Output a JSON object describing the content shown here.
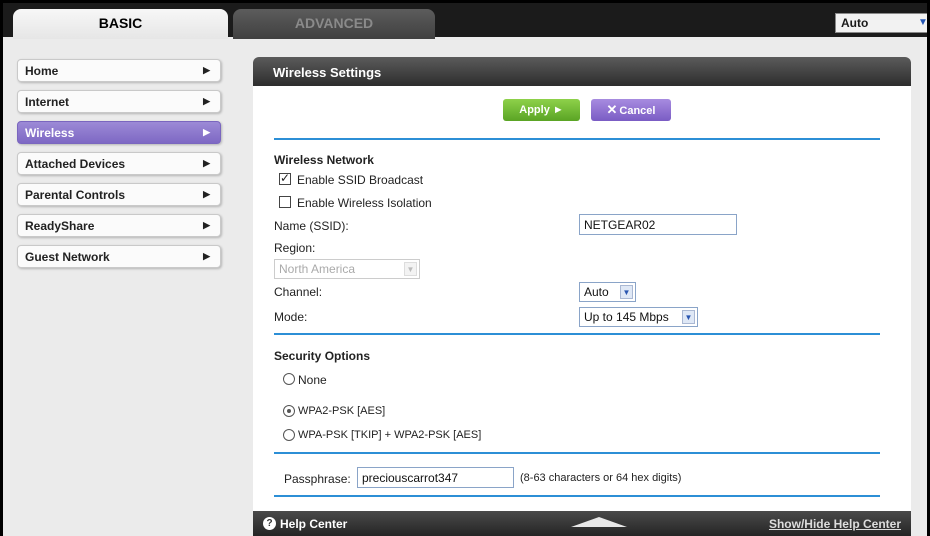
{
  "tabs": {
    "basic": "BASIC",
    "advanced": "ADVANCED"
  },
  "language": {
    "value": "Auto"
  },
  "sidebar": {
    "items": [
      {
        "label": "Home"
      },
      {
        "label": "Internet"
      },
      {
        "label": "Wireless"
      },
      {
        "label": "Attached Devices"
      },
      {
        "label": "Parental Controls"
      },
      {
        "label": "ReadyShare"
      },
      {
        "label": "Guest Network"
      }
    ]
  },
  "panel": {
    "title": "Wireless Settings",
    "apply_label": "Apply ►",
    "cancel_label": "Cancel"
  },
  "wireless_network": {
    "heading": "Wireless Network",
    "enable_ssid_broadcast": {
      "label": "Enable SSID Broadcast",
      "checked": true
    },
    "enable_isolation": {
      "label": "Enable Wireless Isolation",
      "checked": false
    },
    "name_label": "Name (SSID):",
    "name_value": "NETGEAR02",
    "region_label": "Region:",
    "region_value": "North America",
    "channel_label": "Channel:",
    "channel_value": "Auto",
    "mode_label": "Mode:",
    "mode_value": "Up to 145 Mbps"
  },
  "security": {
    "heading": "Security Options",
    "options": [
      {
        "label": "None",
        "checked": false
      },
      {
        "label": "WPA2-PSK [AES]",
        "checked": true
      },
      {
        "label": "WPA-PSK [TKIP] + WPA2-PSK [AES]",
        "checked": false
      }
    ],
    "passphrase_label": "Passphrase:",
    "passphrase_value": "preciouscarrot347",
    "passphrase_hint": "(8-63 characters or 64 hex digits)"
  },
  "footer": {
    "help_label": "Help Center",
    "showhide_label": "Show/Hide Help Center"
  }
}
